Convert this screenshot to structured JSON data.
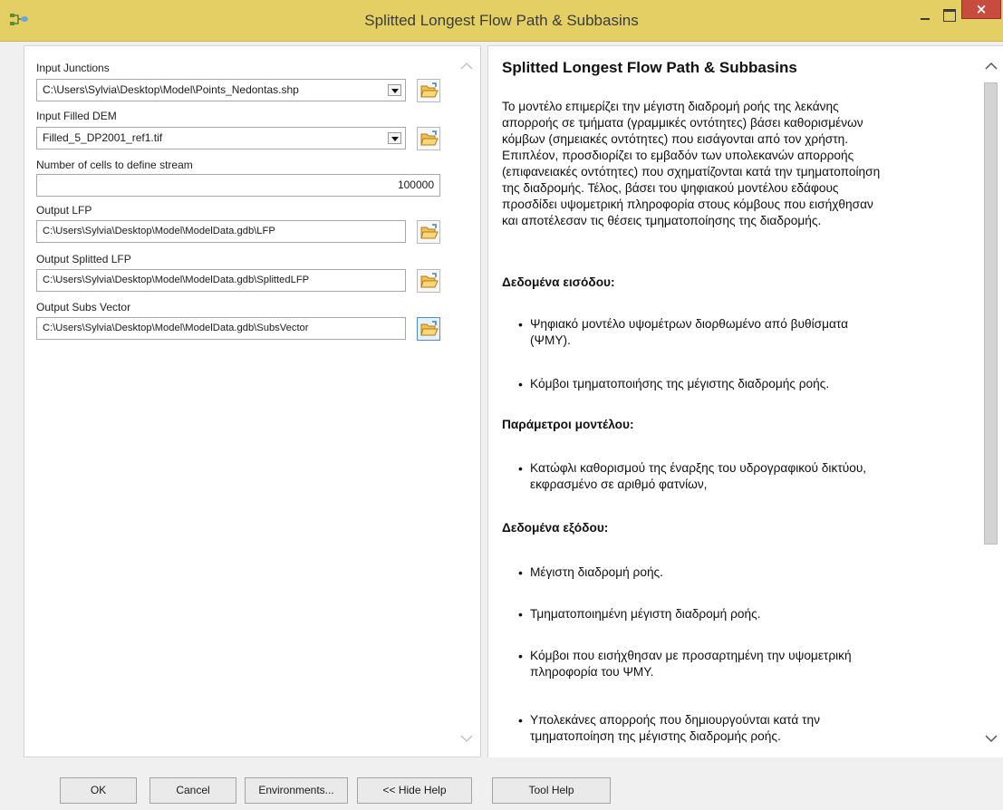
{
  "window": {
    "title": "Splitted Longest Flow Path & Subbasins",
    "close_glyph": "×"
  },
  "form": {
    "input_junctions": {
      "label": "Input Junctions",
      "value": "C:\\Users\\Sylvia\\Desktop\\Model\\Points_Nedontas.shp"
    },
    "input_filled_dem": {
      "label": "Input Filled DEM",
      "value": "Filled_5_DP2001_ref1.tif"
    },
    "number_of_cells": {
      "label": "Number of cells to define stream",
      "value": "100000"
    },
    "output_lfp": {
      "label": "Output LFP",
      "value": "C:\\Users\\Sylvia\\Desktop\\Model\\ModelData.gdb\\LFP"
    },
    "output_splitted_lfp": {
      "label": "Output Splitted LFP",
      "value": "C:\\Users\\Sylvia\\Desktop\\Model\\ModelData.gdb\\SplittedLFP"
    },
    "output_subs_vector": {
      "label": "Output Subs Vector",
      "value": "C:\\Users\\Sylvia\\Desktop\\Model\\ModelData.gdb\\SubsVector"
    }
  },
  "help": {
    "title": "Splitted Longest Flow Path & Subbasins",
    "description_lines": [
      "Το μοντέλο επιμερίζει την μέγιστη διαδρομή ροής της λεκάνης",
      "απορροής σε τμήματα (γραμμικές οντότητες) βάσει καθορισμένων",
      "κόμβων (σημειακές οντότητες) που εισάγονται από τον χρήστη.",
      "Επιπλέον, προσδιορίζει το εμβαδόν των υπολεκανών απορροής",
      "(επιφανειακές οντότητες) που σχηματίζονται κατά την τμηματοποίηση",
      "της διαδρομής. Τέλος, βάσει του ψηφιακού μοντέλου εδάφους",
      "προσδίδει υψομετρική πληροφορία στους κόμβους που εισήχθησαν",
      "και αποτέλεσαν τις θέσεις τμηματοποίησης της διαδρομής."
    ],
    "inputs_heading": "Δεδομένα εισόδου:",
    "inputs": [
      [
        "Ψηφιακό μοντέλο υψομέτρων διορθωμένο από βυθίσματα",
        "(ΨΜΥ)."
      ],
      [
        "Κόμβοι τμηματοποιήσης της μέγιστης διαδρομής ροής."
      ]
    ],
    "params_heading": "Παράμετροι μοντέλου:",
    "params": [
      [
        "Κατώφλι καθορισμού της έναρξης του υδρογραφικού δικτύου,",
        "εκφρασμένο σε αριθμό φατνίων,"
      ]
    ],
    "outputs_heading": "Δεδομένα εξόδου:",
    "outputs": [
      [
        "Μέγιστη διαδρομή ροής."
      ],
      [
        "Τμηματοποιημένη μέγιστη διαδρομή ροής."
      ],
      [
        "Κόμβοι που εισήχθησαν με προσαρτημένη την υψομετρική",
        "πληροφορία του ΨΜΥ."
      ],
      [
        "Υπολεκάνες απορροής που δημιουργούνται κατά την",
        "τμηματοποίηση της μέγιστης διαδρομής ροής."
      ]
    ]
  },
  "buttons": {
    "ok": "OK",
    "cancel": "Cancel",
    "environments": "Environments...",
    "hide_help": "<< Hide Help",
    "tool_help": "Tool Help"
  },
  "icons": {
    "app": "model-icon",
    "browse": "open-folder-icon",
    "dropdown": "chevron-down-icon",
    "scroll_up": "chevron-up-icon",
    "scroll_down": "chevron-down-icon"
  },
  "colors": {
    "titlebar": "#e3cf63",
    "close_button": "#c84b3f"
  }
}
